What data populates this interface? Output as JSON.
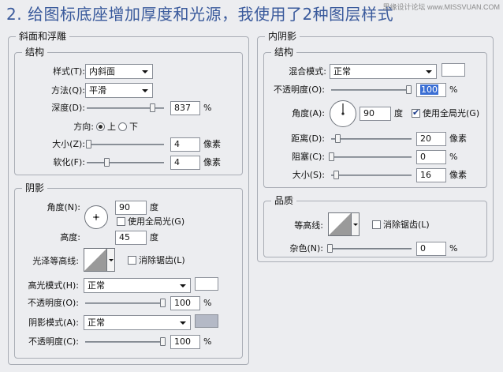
{
  "headline": "2. 给图标底座增加厚度和光源，我使用了2种图层样式",
  "watermark": "思缘设计论坛 www.MISSVUAN.COM",
  "bevel": {
    "title": "斜面和浮雕",
    "structure": {
      "title": "结构",
      "style_label": "样式(T):",
      "style_value": "内斜面",
      "technique_label": "方法(Q):",
      "technique_value": "平滑",
      "depth_label": "深度(D):",
      "depth_value": "837",
      "depth_unit": "%",
      "depth_level": 0.85,
      "direction_label": "方向:",
      "direction_up": "上",
      "direction_down": "下",
      "direction_selected": "上",
      "size_label": "大小(Z):",
      "size_value": "4",
      "size_unit": "像素",
      "size_level": 0.02,
      "soften_label": "软化(F):",
      "soften_value": "4",
      "soften_unit": "像素",
      "soften_level": 0.25
    },
    "shading": {
      "title": "阴影",
      "angle_label": "角度(N):",
      "angle_value": "90",
      "angle_unit": "度",
      "global_light_label": "使用全局光(G)",
      "global_light_checked": false,
      "altitude_label": "高度:",
      "altitude_value": "45",
      "altitude_unit": "度",
      "gloss_label": "光泽等高线:",
      "antialias_label": "消除锯齿(L)",
      "antialias_checked": false,
      "highlight_mode_label": "高光模式(H):",
      "highlight_mode_value": "正常",
      "highlight_color": "#ffffff",
      "highlight_opacity_label": "不透明度(O):",
      "highlight_opacity_value": "100",
      "highlight_opacity_unit": "%",
      "highlight_opacity_level": 1.0,
      "shadow_mode_label": "阴影模式(A):",
      "shadow_mode_value": "正常",
      "shadow_color": "#b4b9c6",
      "shadow_opacity_label": "不透明度(C):",
      "shadow_opacity_value": "100",
      "shadow_opacity_unit": "%",
      "shadow_opacity_level": 1.0
    }
  },
  "inner_shadow": {
    "title": "内阴影",
    "structure": {
      "title": "结构",
      "blend_label": "混合模式:",
      "blend_value": "正常",
      "blend_color": "#ffffff",
      "opacity_label": "不透明度(O):",
      "opacity_value": "100",
      "opacity_unit": "%",
      "opacity_level": 1.0,
      "angle_label": "角度(A):",
      "angle_value": "90",
      "angle_unit": "度",
      "global_light_label": "使用全局光(G)",
      "global_light_checked": true,
      "distance_label": "距离(D):",
      "distance_value": "20",
      "distance_unit": "像素",
      "distance_level": 0.08,
      "choke_label": "阻塞(C):",
      "choke_value": "0",
      "choke_unit": "%",
      "choke_level": 0.0,
      "size_label": "大小(S):",
      "size_value": "16",
      "size_unit": "像素",
      "size_level": 0.06
    },
    "quality": {
      "title": "品质",
      "contour_label": "等高线:",
      "antialias_label": "消除锯齿(L)",
      "antialias_checked": false,
      "noise_label": "杂色(N):",
      "noise_value": "0",
      "noise_unit": "%",
      "noise_level": 0.0
    }
  }
}
